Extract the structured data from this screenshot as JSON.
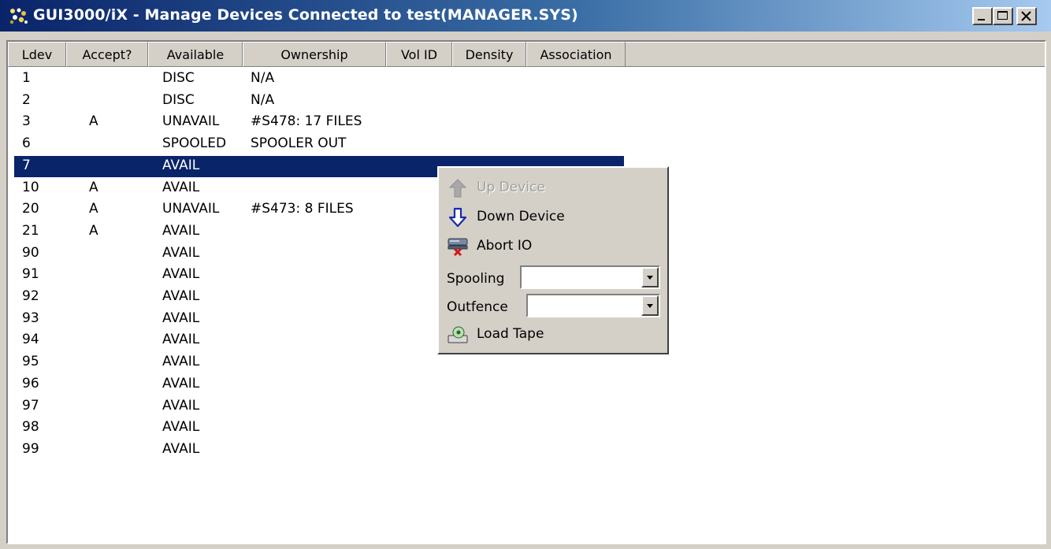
{
  "window": {
    "title": "GUI3000/iX - Manage Devices Connected to test(MANAGER.SYS)"
  },
  "columns": [
    "Ldev",
    "Accept?",
    "Available",
    "Ownership",
    "Vol ID",
    "Density",
    "Association"
  ],
  "rows": [
    {
      "ldev": "1",
      "accept": "",
      "available": "DISC",
      "ownership": "N/A"
    },
    {
      "ldev": "2",
      "accept": "",
      "available": "DISC",
      "ownership": "N/A"
    },
    {
      "ldev": "3",
      "accept": "A",
      "available": "UNAVAIL",
      "ownership": "#S478: 17 FILES"
    },
    {
      "ldev": "6",
      "accept": "",
      "available": "SPOOLED",
      "ownership": "SPOOLER OUT"
    },
    {
      "ldev": "7",
      "accept": "",
      "available": "AVAIL",
      "ownership": ""
    },
    {
      "ldev": "10",
      "accept": "A",
      "available": "AVAIL",
      "ownership": ""
    },
    {
      "ldev": "20",
      "accept": "A",
      "available": "UNAVAIL",
      "ownership": "#S473: 8 FILES"
    },
    {
      "ldev": "21",
      "accept": "A",
      "available": "AVAIL",
      "ownership": ""
    },
    {
      "ldev": "90",
      "accept": "",
      "available": "AVAIL",
      "ownership": ""
    },
    {
      "ldev": "91",
      "accept": "",
      "available": "AVAIL",
      "ownership": ""
    },
    {
      "ldev": "92",
      "accept": "",
      "available": "AVAIL",
      "ownership": ""
    },
    {
      "ldev": "93",
      "accept": "",
      "available": "AVAIL",
      "ownership": ""
    },
    {
      "ldev": "94",
      "accept": "",
      "available": "AVAIL",
      "ownership": ""
    },
    {
      "ldev": "95",
      "accept": "",
      "available": "AVAIL",
      "ownership": ""
    },
    {
      "ldev": "96",
      "accept": "",
      "available": "AVAIL",
      "ownership": ""
    },
    {
      "ldev": "97",
      "accept": "",
      "available": "AVAIL",
      "ownership": ""
    },
    {
      "ldev": "98",
      "accept": "",
      "available": "AVAIL",
      "ownership": ""
    },
    {
      "ldev": "99",
      "accept": "",
      "available": "AVAIL",
      "ownership": ""
    }
  ],
  "selected_row": "7",
  "context_menu": {
    "up_device": "Up Device",
    "down_device": "Down Device",
    "abort_io": "Abort IO",
    "spooling_label": "Spooling",
    "spooling_value": "",
    "outfence_label": "Outfence",
    "outfence_value": "",
    "load_tape": "Load Tape"
  },
  "icons": {
    "app": "app-icon",
    "up": "up-arrow-icon",
    "down": "down-arrow-icon",
    "abort": "abort-io-icon",
    "tape": "load-tape-icon"
  },
  "colors": {
    "selection": "#0a246a",
    "title_start": "#0a246a",
    "title_end": "#a6caf0",
    "face": "#d4d0c8"
  }
}
